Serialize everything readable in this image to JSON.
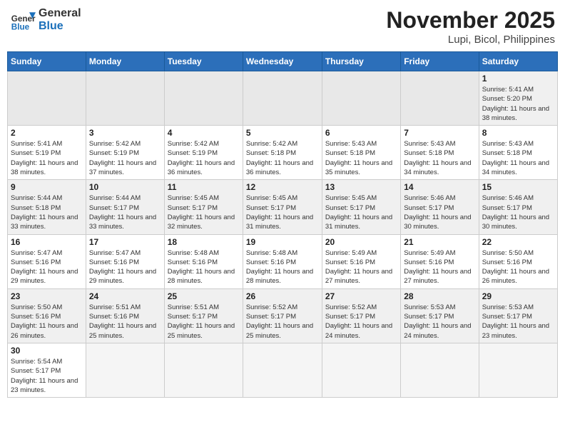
{
  "header": {
    "logo_general": "General",
    "logo_blue": "Blue",
    "month_title": "November 2025",
    "location": "Lupi, Bicol, Philippines"
  },
  "days_of_week": [
    "Sunday",
    "Monday",
    "Tuesday",
    "Wednesday",
    "Thursday",
    "Friday",
    "Saturday"
  ],
  "weeks": [
    [
      {
        "day": "",
        "info": ""
      },
      {
        "day": "",
        "info": ""
      },
      {
        "day": "",
        "info": ""
      },
      {
        "day": "",
        "info": ""
      },
      {
        "day": "",
        "info": ""
      },
      {
        "day": "",
        "info": ""
      },
      {
        "day": "1",
        "info": "Sunrise: 5:41 AM\nSunset: 5:20 PM\nDaylight: 11 hours and 38 minutes."
      }
    ],
    [
      {
        "day": "2",
        "info": "Sunrise: 5:41 AM\nSunset: 5:19 PM\nDaylight: 11 hours and 38 minutes."
      },
      {
        "day": "3",
        "info": "Sunrise: 5:42 AM\nSunset: 5:19 PM\nDaylight: 11 hours and 37 minutes."
      },
      {
        "day": "4",
        "info": "Sunrise: 5:42 AM\nSunset: 5:19 PM\nDaylight: 11 hours and 36 minutes."
      },
      {
        "day": "5",
        "info": "Sunrise: 5:42 AM\nSunset: 5:18 PM\nDaylight: 11 hours and 36 minutes."
      },
      {
        "day": "6",
        "info": "Sunrise: 5:43 AM\nSunset: 5:18 PM\nDaylight: 11 hours and 35 minutes."
      },
      {
        "day": "7",
        "info": "Sunrise: 5:43 AM\nSunset: 5:18 PM\nDaylight: 11 hours and 34 minutes."
      },
      {
        "day": "8",
        "info": "Sunrise: 5:43 AM\nSunset: 5:18 PM\nDaylight: 11 hours and 34 minutes."
      }
    ],
    [
      {
        "day": "9",
        "info": "Sunrise: 5:44 AM\nSunset: 5:18 PM\nDaylight: 11 hours and 33 minutes."
      },
      {
        "day": "10",
        "info": "Sunrise: 5:44 AM\nSunset: 5:17 PM\nDaylight: 11 hours and 33 minutes."
      },
      {
        "day": "11",
        "info": "Sunrise: 5:45 AM\nSunset: 5:17 PM\nDaylight: 11 hours and 32 minutes."
      },
      {
        "day": "12",
        "info": "Sunrise: 5:45 AM\nSunset: 5:17 PM\nDaylight: 11 hours and 31 minutes."
      },
      {
        "day": "13",
        "info": "Sunrise: 5:45 AM\nSunset: 5:17 PM\nDaylight: 11 hours and 31 minutes."
      },
      {
        "day": "14",
        "info": "Sunrise: 5:46 AM\nSunset: 5:17 PM\nDaylight: 11 hours and 30 minutes."
      },
      {
        "day": "15",
        "info": "Sunrise: 5:46 AM\nSunset: 5:17 PM\nDaylight: 11 hours and 30 minutes."
      }
    ],
    [
      {
        "day": "16",
        "info": "Sunrise: 5:47 AM\nSunset: 5:16 PM\nDaylight: 11 hours and 29 minutes."
      },
      {
        "day": "17",
        "info": "Sunrise: 5:47 AM\nSunset: 5:16 PM\nDaylight: 11 hours and 29 minutes."
      },
      {
        "day": "18",
        "info": "Sunrise: 5:48 AM\nSunset: 5:16 PM\nDaylight: 11 hours and 28 minutes."
      },
      {
        "day": "19",
        "info": "Sunrise: 5:48 AM\nSunset: 5:16 PM\nDaylight: 11 hours and 28 minutes."
      },
      {
        "day": "20",
        "info": "Sunrise: 5:49 AM\nSunset: 5:16 PM\nDaylight: 11 hours and 27 minutes."
      },
      {
        "day": "21",
        "info": "Sunrise: 5:49 AM\nSunset: 5:16 PM\nDaylight: 11 hours and 27 minutes."
      },
      {
        "day": "22",
        "info": "Sunrise: 5:50 AM\nSunset: 5:16 PM\nDaylight: 11 hours and 26 minutes."
      }
    ],
    [
      {
        "day": "23",
        "info": "Sunrise: 5:50 AM\nSunset: 5:16 PM\nDaylight: 11 hours and 26 minutes."
      },
      {
        "day": "24",
        "info": "Sunrise: 5:51 AM\nSunset: 5:16 PM\nDaylight: 11 hours and 25 minutes."
      },
      {
        "day": "25",
        "info": "Sunrise: 5:51 AM\nSunset: 5:17 PM\nDaylight: 11 hours and 25 minutes."
      },
      {
        "day": "26",
        "info": "Sunrise: 5:52 AM\nSunset: 5:17 PM\nDaylight: 11 hours and 25 minutes."
      },
      {
        "day": "27",
        "info": "Sunrise: 5:52 AM\nSunset: 5:17 PM\nDaylight: 11 hours and 24 minutes."
      },
      {
        "day": "28",
        "info": "Sunrise: 5:53 AM\nSunset: 5:17 PM\nDaylight: 11 hours and 24 minutes."
      },
      {
        "day": "29",
        "info": "Sunrise: 5:53 AM\nSunset: 5:17 PM\nDaylight: 11 hours and 23 minutes."
      }
    ],
    [
      {
        "day": "30",
        "info": "Sunrise: 5:54 AM\nSunset: 5:17 PM\nDaylight: 11 hours and 23 minutes."
      },
      {
        "day": "",
        "info": ""
      },
      {
        "day": "",
        "info": ""
      },
      {
        "day": "",
        "info": ""
      },
      {
        "day": "",
        "info": ""
      },
      {
        "day": "",
        "info": ""
      },
      {
        "day": "",
        "info": ""
      }
    ]
  ]
}
